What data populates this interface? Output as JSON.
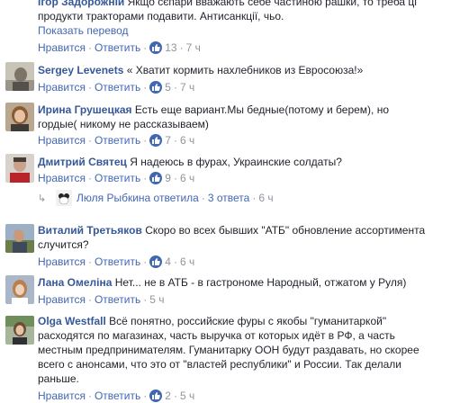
{
  "action_labels": {
    "like": "Нравится",
    "reply": "Ответить",
    "sep": "·"
  },
  "colors": {
    "link": "#365899",
    "action": "#4267b2",
    "meta": "#90949c",
    "like_badge": "#4267b2"
  },
  "comments": [
    {
      "author": "Ігор Задорожній",
      "text_lines": [
        "Якщо сєпари вважають себе частиною рашки, то треба ці",
        "продукти тракторами подавити. Антисанкції, чьо."
      ],
      "translate": "Показать перевод",
      "likes": "13",
      "time": "7 ч",
      "avatar": "avatar-icon"
    },
    {
      "author": "Sergey Levenets",
      "text": "« Хватит кормить нахлебников из Евросоюза!»",
      "likes": "5",
      "time": "7 ч",
      "avatar": "avatar-icon"
    },
    {
      "author": "Ирина Грушецкая",
      "text_lines": [
        "Есть еще вариант.Мы бедные(потому и берем), но",
        "гордые( никому не рассказываем)"
      ],
      "likes": "7",
      "time": "6 ч",
      "avatar": "avatar-icon"
    },
    {
      "author": "Дмитрий Святец",
      "text": "Я надеюсь в фурах, Украинские солдаты?",
      "likes": "9",
      "time": "6 ч",
      "avatar": "avatar-icon",
      "reply_summary": {
        "name": "Люля Рыбкина ответила",
        "count": "3 ответа",
        "time": "6 ч"
      }
    },
    {
      "author": "Виталий Третьяков",
      "text_lines": [
        "Скоро во всех бывших \"АТБ\" обновление ассортимента",
        "случится?"
      ],
      "likes": "4",
      "time": "6 ч",
      "avatar": "avatar-icon"
    },
    {
      "author": "Лана Омеліна",
      "text": "Нет... не в АТБ - в гастрономе Народный, отжатом у Руля)",
      "time": "5 ч",
      "avatar": "avatar-icon"
    },
    {
      "author": "Olga Westfall",
      "text_lines": [
        "Всё понятно, российские фуры с якобы \"гуманитаркой\"",
        "расходятся по магазинах, часть выручка от которых идёт в РФ, а часть",
        "местным предпринимателям. Гуманитарку ООН будут раздавать, но скорее",
        "всего с анонсами, что это от \"властей республики\" и России. Так делали",
        "раньше."
      ],
      "likes": "2",
      "time": "5 ч",
      "avatar": "avatar-icon"
    }
  ]
}
